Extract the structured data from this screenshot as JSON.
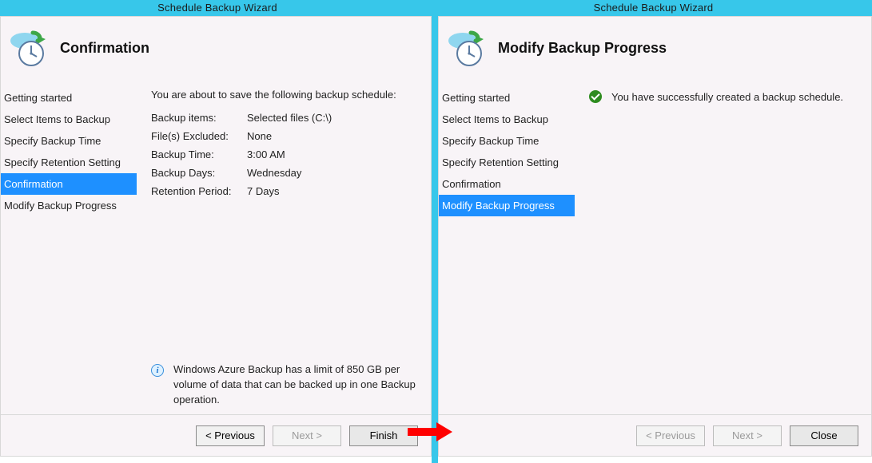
{
  "topbar": {
    "title": "Schedule Backup Wizard"
  },
  "left": {
    "header": {
      "title": "Confirmation"
    },
    "side": {
      "items": [
        {
          "label": "Getting started"
        },
        {
          "label": "Select Items to Backup"
        },
        {
          "label": "Specify Backup Time"
        },
        {
          "label": "Specify Retention Setting"
        },
        {
          "label": "Confirmation",
          "active": true
        },
        {
          "label": "Modify Backup Progress"
        }
      ]
    },
    "content": {
      "intro": "You are about to save the following backup schedule:",
      "rows": [
        {
          "k": "Backup items:",
          "v": "Selected files (C:\\)"
        },
        {
          "k": "File(s) Excluded:",
          "v": "None"
        },
        {
          "k": "Backup Time:",
          "v": "3:00 AM"
        },
        {
          "k": "Backup Days:",
          "v": "Wednesday"
        },
        {
          "k": "Retention Period:",
          "v": "7 Days"
        }
      ],
      "info": "Windows Azure Backup has a limit of 850 GB per volume of data that can be backed up in one Backup operation."
    },
    "footer": {
      "previous": "< Previous",
      "next": "Next >",
      "primary": "Finish"
    }
  },
  "right": {
    "header": {
      "title": "Modify Backup Progress"
    },
    "side": {
      "items": [
        {
          "label": "Getting started"
        },
        {
          "label": "Select Items to Backup"
        },
        {
          "label": "Specify Backup Time"
        },
        {
          "label": "Specify Retention Setting"
        },
        {
          "label": "Confirmation"
        },
        {
          "label": "Modify Backup Progress",
          "active": true
        }
      ]
    },
    "content": {
      "success": "You have successfully created a backup schedule."
    },
    "footer": {
      "previous": "< Previous",
      "next": "Next >",
      "primary": "Close"
    }
  }
}
